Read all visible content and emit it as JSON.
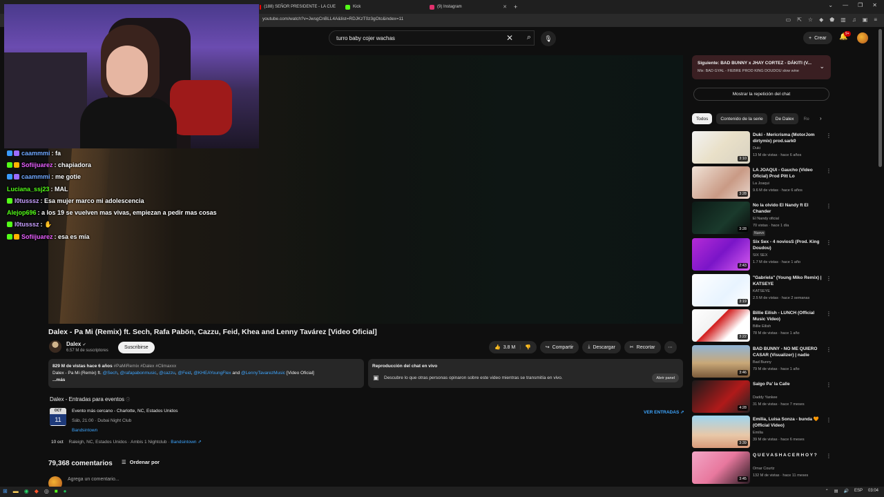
{
  "browser": {
    "tabs": [
      {
        "label": "(188) SEÑOR PRESIDENTE - LA CUE",
        "color": "#ff0000"
      },
      {
        "label": "Kick",
        "color": "#53fc18"
      },
      {
        "label": "(9) Instagram",
        "color": "#e1306c"
      }
    ],
    "new_tab": "+",
    "url": "youtube.com/watch?v=JwsgCnBLL4A&list=RDJKzT0z3gOtc&index=11"
  },
  "header": {
    "search_value": "turro baby cojer wachas",
    "create_label": "Crear",
    "notif_count": "9+"
  },
  "chat": [
    {
      "user": "caammmi",
      "color": "#6fa8ff",
      "message": ": fa",
      "badges": [
        "#3a9bff",
        "#9b6bff"
      ]
    },
    {
      "user": "Sofiijuarez",
      "color": "#e85fff",
      "message": ": chapiadora",
      "badges": [
        "#53fc18",
        "#ffb400"
      ]
    },
    {
      "user": "caammmi",
      "color": "#6fa8ff",
      "message": ": me gotie",
      "badges": [
        "#3a9bff",
        "#9b6bff"
      ]
    },
    {
      "user": "Luciana_ssj23",
      "color": "#53fc18",
      "message": ": MAL",
      "badges": []
    },
    {
      "user": "l0tusssz",
      "color": "#c8a0ff",
      "message": ": Esa mujer marco mi adolescencia",
      "badges": [
        "#53fc18"
      ]
    },
    {
      "user": "Alejop696",
      "color": "#53fc18",
      "message": ": a los 19 se vuelven mas vivas, empiezan a pedir mas cosas",
      "badges": []
    },
    {
      "user": "l0tusssz",
      "color": "#c8a0ff",
      "message": ": ✋",
      "badges": [
        "#53fc18"
      ]
    },
    {
      "user": "Sofiijuarez",
      "color": "#e85fff",
      "message": ": esa es mía",
      "badges": [
        "#53fc18",
        "#ffb400"
      ]
    }
  ],
  "video": {
    "title": "Dalex - Pa Mi (Remix) ft. Sech, Rafa Pabön, Cazzu, Feid, Khea and Lenny Tavárez [Video Oficial]",
    "channel": "Dalex",
    "subscribers": "6.57 M de suscriptores",
    "subscribe_label": "Suscribirse",
    "likes": "3.8 M",
    "share_label": "Compartir",
    "download_label": "Descargar",
    "clip_label": "Recortar"
  },
  "description": {
    "meta": "829 M de vistas  hace 6 años",
    "tags": "#PaMiRemix #Dalex #Climaxxx",
    "line2_prefix": "Dalex - Pa Mi (Remix) ft.",
    "mentions": [
      "@Sech",
      "@rafapabonmusic",
      "@cazzu",
      "@Feid",
      "@KHEAYoungFlex"
    ],
    "and": "and",
    "mention_last": "@LennyTavarezMusic",
    "line2_suffix": "[Video Oficial]",
    "more": "...más"
  },
  "chat_replay": {
    "title": "Reproducción del chat en vivo",
    "text": "Descubre lo que otras personas opinaron sobre este video mientras se transmitía en vivo.",
    "button": "Abrir panel"
  },
  "events": {
    "title": "Dalex - Entradas para eventos",
    "month": "OCT",
    "day": "11",
    "event_title": "Evento más cercano - Charlotte, NC, Estados Unidos",
    "event_when": "Sáb, 21:00 · Dubai Night Club",
    "source": "Bandsintown",
    "tickets": "VER ENTRADAS",
    "next_date": "10 oct",
    "next_place": "Raleigh, NC, Estados Unidos · Ambis 1 Nightclub ·",
    "next_source": "Bandsintown"
  },
  "comments": {
    "count": "79,368 comentarios",
    "sort": "Ordenar por",
    "placeholder": "Agrega un comentario..."
  },
  "sidebar": {
    "next_title": "Siguiente: BAD BUNNY x JHAY CORTEZ - DÁKITI (V...",
    "next_sub": "Mix: BAD GYAL - FIEBRE PROD KING DOUDOU slow wine",
    "show_chat": "Mostrar la repetición del chat",
    "chips": [
      "Todos",
      "Contenido de la serie",
      "De Dalex",
      "Re"
    ],
    "recs": [
      {
        "title": "Duki - Mericrisma (MotorJom dirtymix) prod.sark0",
        "channel": "Duki",
        "views": "13 M de vistas · hace 6 años",
        "duration": "3:10",
        "thumb": "linear-gradient(135deg,#f3f3f3 0%,#e9e0c8 50%,#d8d2c2 100%)"
      },
      {
        "title": "LA JOAQUI - Gaucho (Video Oficial) Prod Pitt Lo",
        "channel": "La Joaqui",
        "views": "9.6 M de vistas · hace 6 años",
        "duration": "3:28",
        "thumb": "linear-gradient(135deg,#f0e2d6 0%,#c99a85 60%,#e8d6cc 100%)"
      },
      {
        "title": "No la olvido El Nandy ft El Chander",
        "channel": "El Nandy oficial",
        "views": "70 vistas · hace 1 día",
        "duration": "3:28",
        "thumb": "linear-gradient(135deg,#0c1a16 0%,#1a3a2c 60%,#0a0a0a 100%)",
        "badge": "Nuevo"
      },
      {
        "title": "Six Sex - 4 noviosS (Prod. King Doudou)",
        "channel": "SIX SEX",
        "views": "1.7 M de vistas · hace 1 año",
        "duration": "2:43",
        "thumb": "linear-gradient(135deg,#b52bd6 0%,#7a15c8 50%,#d85cf0 100%)"
      },
      {
        "title": "\"Gabriela\" (Young Miko Remix) | KATSEYE",
        "channel": "KATSEYE",
        "views": "2.5 M de vistas · hace 2 semanas",
        "duration": "3:19",
        "thumb": "linear-gradient(135deg,#ffffff 0%,#e8f4ff 60%,#ffffff 100%)"
      },
      {
        "title": "Billie Eilish - LUNCH (Official Music Video)",
        "channel": "Billie Eilish",
        "views": "78 M de vistas · hace 1 año",
        "duration": "3:22",
        "thumb": "linear-gradient(135deg,#ffffff 0%,#f2f2f2 40%,#d11a1a 41%,#ffffff 70%)"
      },
      {
        "title": "BAD BUNNY - NO ME QUIERO CASAR (Visualizer) | nadie sab...",
        "channel": "Bad Bunny",
        "views": "79 M de vistas · hace 1 año",
        "duration": "3:46",
        "thumb": "linear-gradient(180deg,#8fb4d6 0%,#c9a878 55%,#7a5a3a 100%)"
      },
      {
        "title": "Salgo Pa' la Calle",
        "channel": "Daddy Yankee",
        "views": "31 M de vistas · hace 7 meses",
        "duration": "4:28",
        "thumb": "linear-gradient(135deg,#1a1a1a 0%,#b01a1a 60%,#222 100%)"
      },
      {
        "title": "Emilia, Luisa Sonza - bunda 🧡 (Official Video)",
        "channel": "Emilia",
        "views": "39 M de vistas · hace 6 meses",
        "duration": "3:39",
        "thumb": "linear-gradient(180deg,#9fd6f0 0%,#e8c8a8 60%,#d89a7a 100%)"
      },
      {
        "title": "Q U E V A S H A C E R H O Y ?",
        "channel": "Omar Courtz",
        "views": "132 M de vistas · hace 11 meses",
        "duration": "3:45",
        "thumb": "linear-gradient(135deg,#f2a6c6 0%,#e8789e 50%,#2a1a22 100%)"
      }
    ]
  },
  "taskbar": {
    "lang": "ESP",
    "time": "03:04"
  }
}
